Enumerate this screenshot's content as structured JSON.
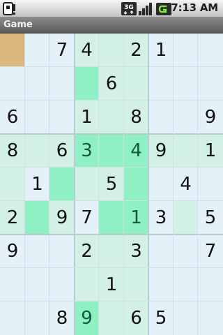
{
  "status_bar": {
    "time": "7:13 AM",
    "network_label": "3G",
    "icons": [
      "notification-icon",
      "network-3g-icon",
      "signal-icon",
      "battery-icon"
    ]
  },
  "title_bar": {
    "title": "Game"
  },
  "colors": {
    "cell_default": "#e4f1f9",
    "cell_light_highlight": "#d2f0e3",
    "cell_strong_highlight": "#8ff0c3",
    "cell_selected": "#dbb67e",
    "digit": "#111111",
    "digit_highlighted": "#0f5a3e"
  },
  "board": {
    "selected": [
      0,
      0
    ],
    "rows": [
      [
        "",
        "",
        "7",
        "4",
        "",
        "2",
        "1",
        "",
        ""
      ],
      [
        "",
        "",
        "",
        "",
        "6",
        "",
        "",
        "",
        ""
      ],
      [
        "6",
        "",
        "",
        "1",
        "",
        "8",
        "",
        "",
        "9"
      ],
      [
        "8",
        "",
        "6",
        "3",
        "",
        "4",
        "9",
        "",
        "1"
      ],
      [
        "",
        "1",
        "",
        "",
        "5",
        "",
        "",
        "4",
        ""
      ],
      [
        "2",
        "",
        "9",
        "7",
        "",
        "1",
        "3",
        "",
        "5"
      ],
      [
        "9",
        "",
        "",
        "2",
        "",
        "3",
        "",
        "",
        "7"
      ],
      [
        "",
        "",
        "",
        "",
        "1",
        "",
        "",
        "",
        ""
      ],
      [
        "",
        "",
        "8",
        "9",
        "",
        "6",
        "5",
        "",
        ""
      ]
    ],
    "highlight": [
      [
        0,
        0,
        0,
        1,
        1,
        1,
        0,
        0,
        0
      ],
      [
        0,
        0,
        0,
        2,
        1,
        1,
        0,
        0,
        0
      ],
      [
        0,
        0,
        0,
        1,
        1,
        1,
        0,
        0,
        0
      ],
      [
        1,
        1,
        1,
        2,
        2,
        2,
        1,
        1,
        1
      ],
      [
        1,
        0,
        2,
        1,
        1,
        2,
        0,
        0,
        0
      ],
      [
        1,
        2,
        1,
        0,
        2,
        2,
        0,
        1,
        0
      ],
      [
        0,
        0,
        0,
        1,
        1,
        1,
        0,
        0,
        0
      ],
      [
        0,
        0,
        0,
        1,
        1,
        1,
        0,
        0,
        0
      ],
      [
        0,
        0,
        0,
        2,
        1,
        1,
        0,
        0,
        0
      ]
    ]
  }
}
